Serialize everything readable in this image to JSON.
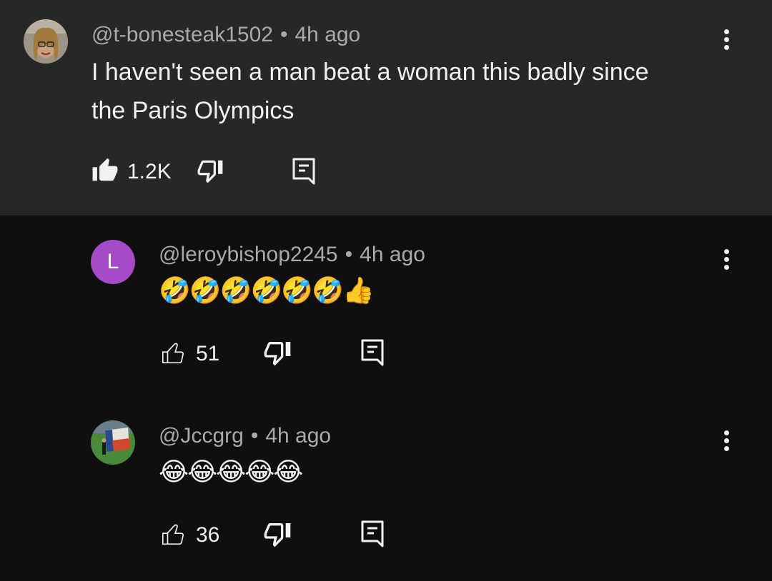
{
  "comments": [
    {
      "handle": "@t-bonesteak1502",
      "time": "4h ago",
      "text_line1": "I haven't seen a man beat a woman this badly since",
      "text_line2": "the Paris Olympics",
      "likes": "1.2K",
      "liked": true
    },
    {
      "handle": "@leroybishop2245",
      "time": "4h ago",
      "avatar_letter": "L",
      "avatar_color": "#a64bc7",
      "text": "🤣🤣🤣🤣🤣🤣👍",
      "likes": "51",
      "liked": false
    },
    {
      "handle": "@Jccgrg",
      "time": "4h ago",
      "text": "😂😂😂😂😂",
      "likes": "36",
      "liked": false
    }
  ],
  "separator": "•",
  "icons": {
    "like": "thumbs-up-icon",
    "dislike": "thumbs-down-icon",
    "reply": "reply-comment-icon",
    "more": "more-vertical-icon"
  },
  "colors": {
    "background": "#0f0f0f",
    "highlight": "#272727",
    "meta_text": "#aaaaaa"
  }
}
